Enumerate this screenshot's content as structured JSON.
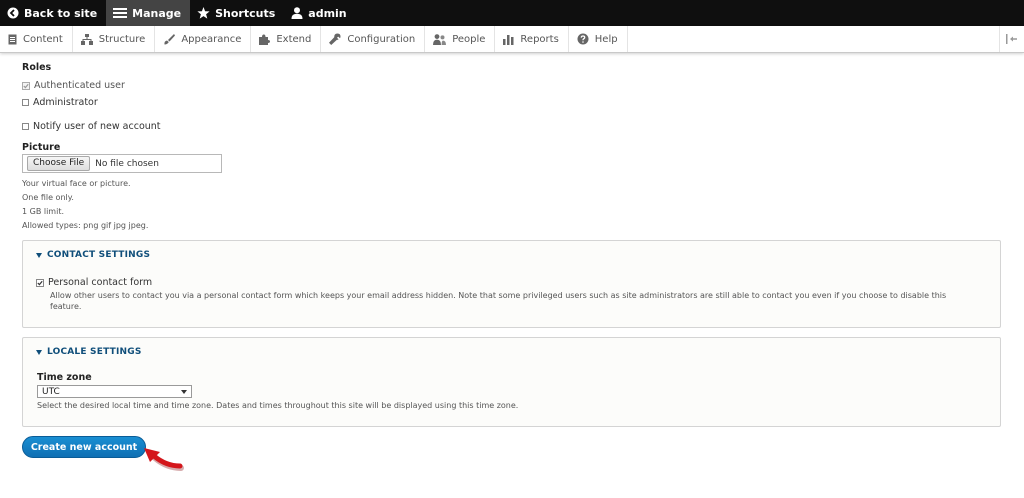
{
  "toolbar": {
    "items": [
      {
        "label": "Back to site",
        "icon": "back-arrow-icon"
      },
      {
        "label": "Manage",
        "icon": "hamburger-menu-icon",
        "active": true
      },
      {
        "label": "Shortcuts",
        "icon": "star-icon"
      },
      {
        "label": "admin",
        "icon": "user-icon"
      }
    ]
  },
  "tray": {
    "items": [
      {
        "label": "Content",
        "icon": "document-icon"
      },
      {
        "label": "Structure",
        "icon": "sitemap-icon"
      },
      {
        "label": "Appearance",
        "icon": "paintbrush-icon"
      },
      {
        "label": "Extend",
        "icon": "puzzle-icon"
      },
      {
        "label": "Configuration",
        "icon": "wrench-icon"
      },
      {
        "label": "People",
        "icon": "people-icon"
      },
      {
        "label": "Reports",
        "icon": "bar-chart-icon"
      },
      {
        "label": "Help",
        "icon": "help-icon"
      }
    ]
  },
  "form": {
    "roles": {
      "label": "Roles",
      "options": [
        {
          "label": "Authenticated user",
          "checked": true,
          "disabled": true
        },
        {
          "label": "Administrator",
          "checked": false
        }
      ]
    },
    "notify": {
      "label": "Notify user of new account",
      "checked": false
    },
    "picture": {
      "label": "Picture",
      "button": "Choose File",
      "status": "No file chosen",
      "descriptions": [
        "Your virtual face or picture.",
        "One file only.",
        "1 GB limit.",
        "Allowed types: png gif jpg jpeg."
      ]
    },
    "contact": {
      "legend": "CONTACT SETTINGS",
      "checkbox_label": "Personal contact form",
      "checked": true,
      "description_1": "Allow other users to contact you via a personal contact form which keeps your email address hidden. Note that some privileged users such as site administrators are still able to contact you even if you choose to disable this",
      "description_2": "feature."
    },
    "locale": {
      "legend": "LOCALE SETTINGS",
      "timezone_label": "Time zone",
      "timezone_value": "UTC",
      "description": "Select the desired local time and time zone. Dates and times throughout this site will be displayed using this time zone."
    },
    "submit": "Create new account"
  },
  "colors": {
    "toolbar_bg": "#0f0f0f",
    "legend": "#0f4e7a",
    "button": "#1278c0",
    "annotation_arrow": "#d4161b"
  }
}
